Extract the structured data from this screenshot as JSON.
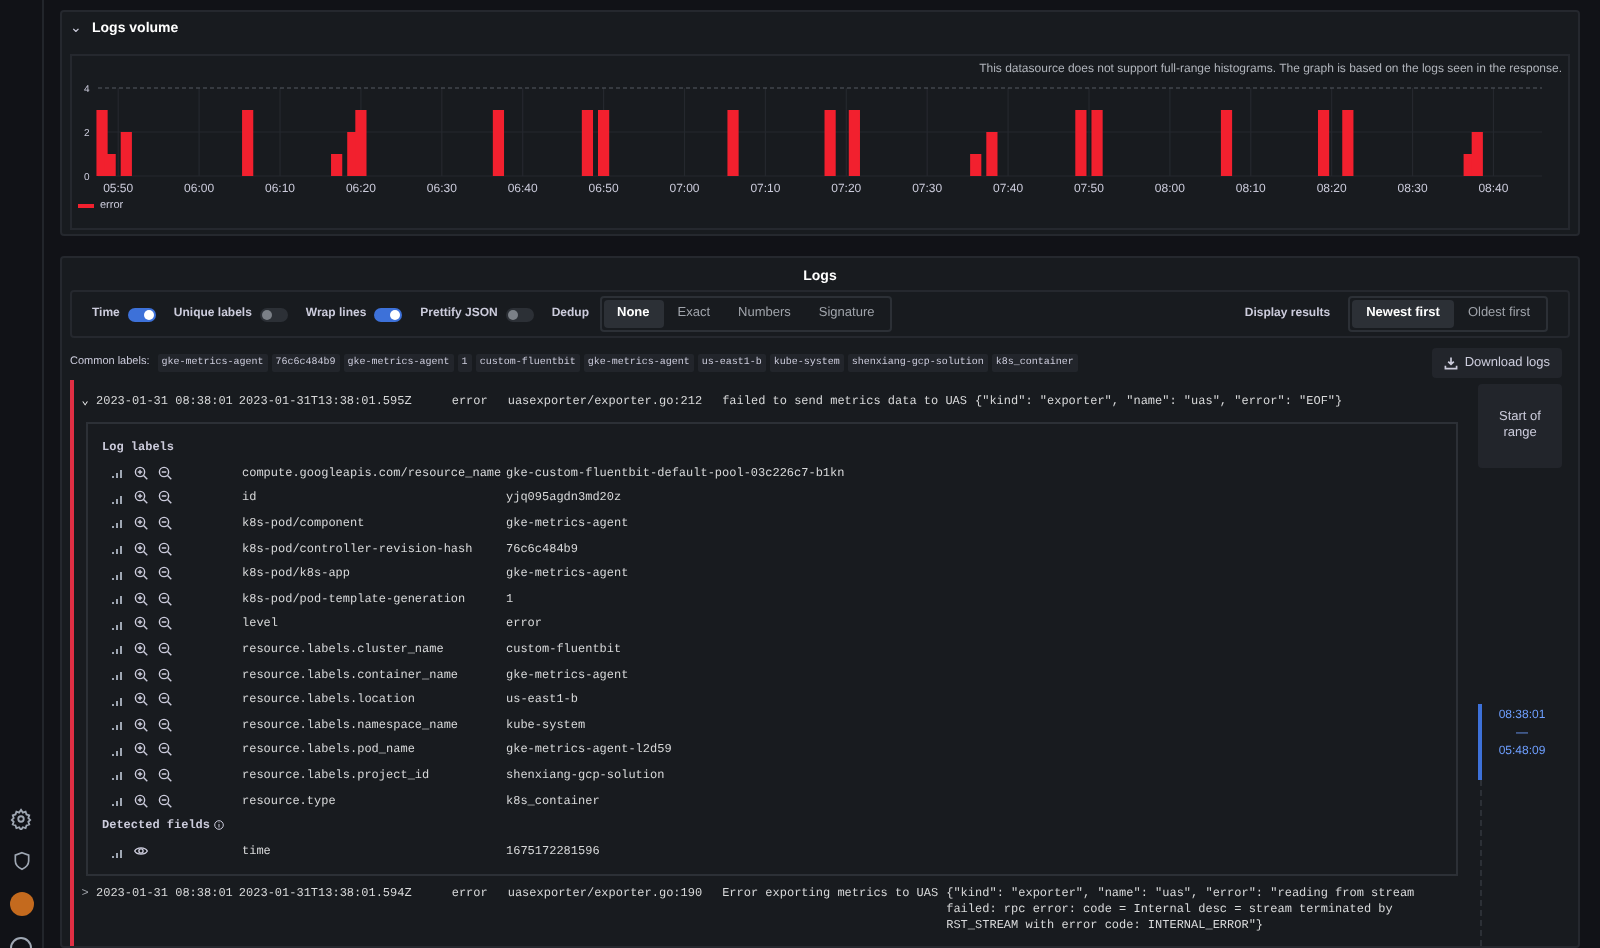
{
  "logs_volume": {
    "title": "Logs volume",
    "chevron": "⌄",
    "notice": "This datasource does not support full-range histograms. The graph is based on the logs seen in the response.",
    "chart_data": {
      "type": "bar",
      "grid": true,
      "x": [
        348,
        349,
        351,
        366,
        377,
        379,
        380,
        397,
        408,
        410,
        426,
        438,
        441,
        456,
        458,
        469,
        471,
        487,
        499,
        502,
        517,
        518
      ],
      "series": [
        {
          "name": "error",
          "color": "#f2202e",
          "values": [
            3,
            1,
            2,
            3,
            1,
            2,
            3,
            3,
            3,
            3,
            3,
            3,
            3,
            1,
            2,
            3,
            3,
            3,
            3,
            3,
            1,
            2
          ]
        }
      ],
      "xlim": [
        347.5,
        526
      ],
      "ylim": [
        0,
        4
      ],
      "yticks": [
        0,
        2,
        4
      ],
      "xticks": [
        {
          "value": 350,
          "label": "05:50"
        },
        {
          "value": 360,
          "label": "06:00"
        },
        {
          "value": 370,
          "label": "06:10"
        },
        {
          "value": 380,
          "label": "06:20"
        },
        {
          "value": 390,
          "label": "06:30"
        },
        {
          "value": 400,
          "label": "06:40"
        },
        {
          "value": 410,
          "label": "06:50"
        },
        {
          "value": 420,
          "label": "07:00"
        },
        {
          "value": 430,
          "label": "07:10"
        },
        {
          "value": 440,
          "label": "07:20"
        },
        {
          "value": 450,
          "label": "07:30"
        },
        {
          "value": 460,
          "label": "07:40"
        },
        {
          "value": 470,
          "label": "07:50"
        },
        {
          "value": 480,
          "label": "08:00"
        },
        {
          "value": 490,
          "label": "08:10"
        },
        {
          "value": 500,
          "label": "08:20"
        },
        {
          "value": 510,
          "label": "08:30"
        },
        {
          "value": 520,
          "label": "08:40"
        }
      ]
    }
  },
  "logs": {
    "title": "Logs",
    "switches": [
      {
        "label": "Time",
        "on": true
      },
      {
        "label": "Unique labels",
        "on": false
      },
      {
        "label": "Wrap lines",
        "on": true
      },
      {
        "label": "Prettify JSON",
        "on": false
      }
    ],
    "dedup": {
      "label": "Dedup",
      "options": [
        {
          "label": "None",
          "selected": true
        },
        {
          "label": "Exact",
          "selected": false
        },
        {
          "label": "Numbers",
          "selected": false
        },
        {
          "label": "Signature",
          "selected": false
        }
      ]
    },
    "display_results": {
      "label": "Display results",
      "options": [
        {
          "label": "Newest first",
          "selected": true
        },
        {
          "label": "Oldest first",
          "selected": false
        }
      ]
    },
    "common_labels": {
      "label": "Common labels:",
      "values": [
        "gke-metrics-agent",
        "76c6c484b9",
        "gke-metrics-agent",
        "1",
        "custom-fluentbit",
        "gke-metrics-agent",
        "us-east1-b",
        "kube-system",
        "shenxiang-gcp-solution",
        "k8s_container"
      ]
    },
    "download_button": "Download logs",
    "rows": [
      {
        "expanded": true,
        "chevron": "⌄",
        "time": "2023-01-31 08:38:01",
        "timestamp": "2023-01-31T13:38:01.595Z",
        "level": "error",
        "caller": "uasexporter/exporter.go:212",
        "message": "failed to send metrics data to UAS",
        "fields": "{\"kind\": \"exporter\", \"name\": \"uas\", \"error\": \"EOF\"}",
        "details": {
          "title": "Log labels",
          "labels": [
            {
              "key": "compute.googleapis.com/resource_name",
              "value": "gke-custom-fluentbit-default-pool-03c226c7-b1kn"
            },
            {
              "key": "id",
              "value": "yjq095agdn3md20z"
            },
            {
              "key": "k8s-pod/component",
              "value": "gke-metrics-agent"
            },
            {
              "key": "k8s-pod/controller-revision-hash",
              "value": "76c6c484b9"
            },
            {
              "key": "k8s-pod/k8s-app",
              "value": "gke-metrics-agent"
            },
            {
              "key": "k8s-pod/pod-template-generation",
              "value": "1"
            },
            {
              "key": "level",
              "value": "error"
            },
            {
              "key": "resource.labels.cluster_name",
              "value": "custom-fluentbit"
            },
            {
              "key": "resource.labels.container_name",
              "value": "gke-metrics-agent"
            },
            {
              "key": "resource.labels.location",
              "value": "us-east1-b"
            },
            {
              "key": "resource.labels.namespace_name",
              "value": "kube-system"
            },
            {
              "key": "resource.labels.pod_name",
              "value": "gke-metrics-agent-l2d59"
            },
            {
              "key": "resource.labels.project_id",
              "value": "shenxiang-gcp-solution"
            },
            {
              "key": "resource.type",
              "value": "k8s_container"
            }
          ],
          "detected_title": "Detected fields",
          "fields": [
            {
              "key": "time",
              "value": "1675172281596"
            }
          ]
        }
      },
      {
        "expanded": false,
        "chevron": ">",
        "time": "2023-01-31 08:38:01",
        "timestamp": "2023-01-31T13:38:01.594Z",
        "level": "error",
        "caller": "uasexporter/exporter.go:190",
        "message": "Error exporting metrics to UAS",
        "fields": "{\"kind\": \"exporter\", \"name\": \"uas\", \"error\": \"reading from stream failed: rpc error: code = Internal desc = stream terminated by RST_STREAM with error code: INTERNAL_ERROR\"}"
      }
    ],
    "range": {
      "button": "Start of range",
      "start": "08:38:01",
      "separator": "—",
      "end": "05:48:09"
    }
  }
}
